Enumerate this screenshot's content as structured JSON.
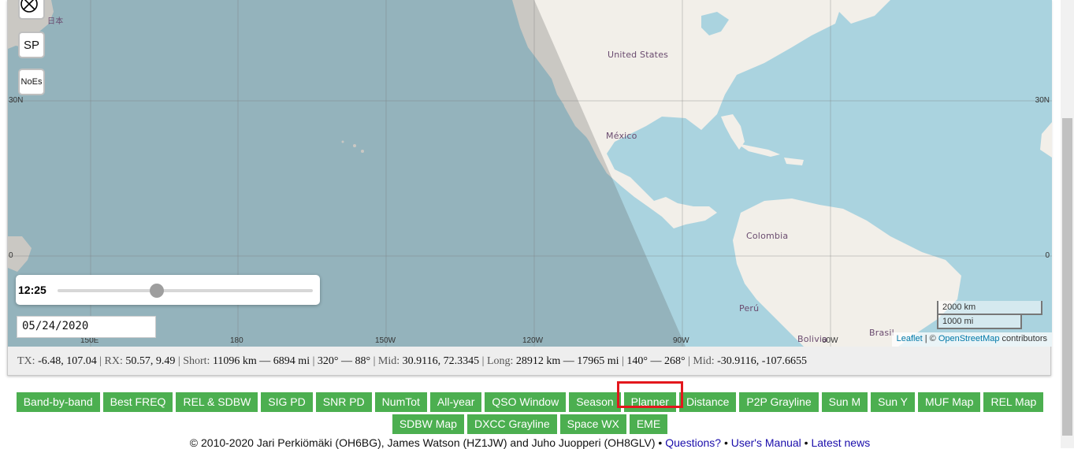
{
  "map": {
    "controls": {
      "blackout_icon": "circle-x-icon",
      "sp_label": "SP",
      "noes_label": "NoEs"
    },
    "lat_labels": {
      "north_left": "30N",
      "north_right": "30N",
      "equator_left": "0",
      "equator_right": "0"
    },
    "lon_labels": {
      "a": "150E",
      "b": "180",
      "c": "150W",
      "d": "120W",
      "e": "90W",
      "f": "60W"
    },
    "places": {
      "japan": "日本",
      "usa": "United States",
      "mexico": "México",
      "colombia": "Colombia",
      "peru": "Perú",
      "brasil": "Brasil",
      "bolivia": "Bolivia"
    },
    "time_slider": {
      "label": "12:25",
      "fraction": 0.39
    },
    "date_value": "05/24/2020",
    "scale": {
      "km": "2000 km",
      "mi": "1000 mi"
    },
    "attribution": {
      "leaflet": "Leaflet",
      "sep": " | © ",
      "osm": "OpenStreetMap",
      "suffix": " contributors"
    }
  },
  "info": {
    "tx_label": "TX:",
    "tx": "-6.48, 107.04",
    "rx_label": "RX:",
    "rx": "50.57, 9.49",
    "short_label": "Short:",
    "short": "11096 km — 6894 mi",
    "short_bearing": "320° — 88°",
    "mid_label": "Mid:",
    "mid": "30.9116, 72.3345",
    "long_label": "Long:",
    "long": "28912 km — 17965 mi",
    "long_bearing": "140° — 268°",
    "mid2_label": "Mid:",
    "mid2": "-30.9116, -107.6655"
  },
  "buttons_row1": [
    "Band-by-band",
    "Best FREQ",
    "REL & SDBW",
    "SIG PD",
    "SNR PD",
    "NumTot",
    "All-year",
    "QSO Window",
    "Season",
    "Planner",
    "Distance",
    "P2P Grayline",
    "Sun M",
    "Sun Y",
    "MUF Map",
    "REL Map"
  ],
  "buttons_row2": [
    "SDBW Map",
    "DXCC Grayline",
    "Space WX",
    "EME"
  ],
  "footer": {
    "text": "© 2010-2020 Jari Perkiömäki (OH6BG), James Watson (HZ1JW) and Juho Juopperi (OH8GLV)",
    "sep1": " • ",
    "questions": "Questions?",
    "sep2": " • ",
    "manual": "User's Manual",
    "sep3": " • ",
    "news": "Latest news"
  },
  "colors": {
    "ocean": "#aad3df",
    "land": "#f2efe9",
    "night": "#555555",
    "button": "#4caf50",
    "highlight": "#e3171d"
  }
}
